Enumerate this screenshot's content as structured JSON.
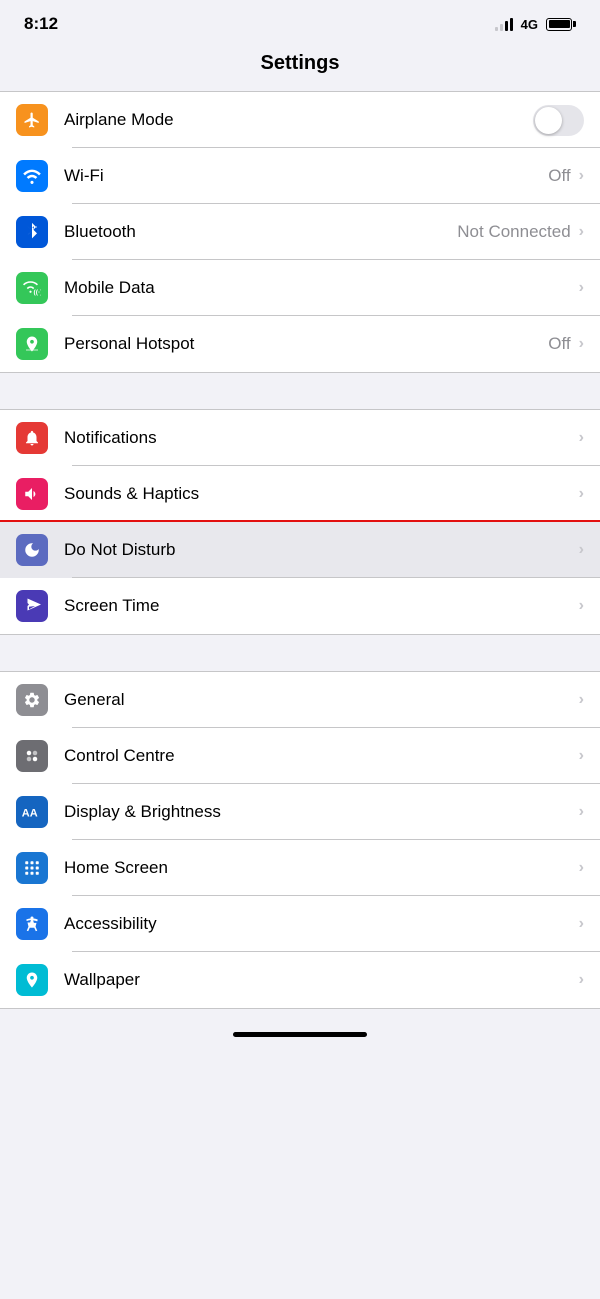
{
  "statusBar": {
    "time": "8:12",
    "networkType": "4G",
    "batteryFull": true
  },
  "pageTitle": "Settings",
  "groups": [
    {
      "id": "connectivity",
      "items": [
        {
          "id": "airplane-mode",
          "label": "Airplane Mode",
          "iconBg": "bg-orange",
          "iconSymbol": "✈",
          "hasToggle": true,
          "toggleOn": false,
          "value": "",
          "hasChevron": false
        },
        {
          "id": "wifi",
          "label": "Wi-Fi",
          "iconBg": "bg-blue",
          "iconSymbol": "wifi",
          "hasToggle": false,
          "value": "Off",
          "hasChevron": true
        },
        {
          "id": "bluetooth",
          "label": "Bluetooth",
          "iconBg": "bg-blue-dark",
          "iconSymbol": "bluetooth",
          "hasToggle": false,
          "value": "Not Connected",
          "hasChevron": true
        },
        {
          "id": "mobile-data",
          "label": "Mobile Data",
          "iconBg": "bg-green",
          "iconSymbol": "signal",
          "hasToggle": false,
          "value": "",
          "hasChevron": true
        },
        {
          "id": "personal-hotspot",
          "label": "Personal Hotspot",
          "iconBg": "bg-green",
          "iconSymbol": "hotspot",
          "hasToggle": false,
          "value": "Off",
          "hasChevron": true
        }
      ]
    },
    {
      "id": "notifications",
      "items": [
        {
          "id": "notifications",
          "label": "Notifications",
          "iconBg": "bg-red",
          "iconSymbol": "notif",
          "hasToggle": false,
          "value": "",
          "hasChevron": true
        },
        {
          "id": "sounds-haptics",
          "label": "Sounds & Haptics",
          "iconBg": "bg-red-pink",
          "iconSymbol": "sound",
          "hasToggle": false,
          "value": "",
          "hasChevron": true
        },
        {
          "id": "do-not-disturb",
          "label": "Do Not Disturb",
          "iconBg": "bg-purple",
          "iconSymbol": "moon",
          "hasToggle": false,
          "value": "",
          "hasChevron": true,
          "highlighted": true
        },
        {
          "id": "screen-time",
          "label": "Screen Time",
          "iconBg": "bg-purple-dark",
          "iconSymbol": "hourglass",
          "hasToggle": false,
          "value": "",
          "hasChevron": true
        }
      ]
    },
    {
      "id": "display",
      "items": [
        {
          "id": "general",
          "label": "General",
          "iconBg": "bg-gray",
          "iconSymbol": "gear",
          "hasToggle": false,
          "value": "",
          "hasChevron": true
        },
        {
          "id": "control-centre",
          "label": "Control Centre",
          "iconBg": "bg-gray2",
          "iconSymbol": "switches",
          "hasToggle": false,
          "value": "",
          "hasChevron": true
        },
        {
          "id": "display-brightness",
          "label": "Display & Brightness",
          "iconBg": "bg-blue2",
          "iconSymbol": "aa",
          "hasToggle": false,
          "value": "",
          "hasChevron": true
        },
        {
          "id": "home-screen",
          "label": "Home Screen",
          "iconBg": "bg-blue3",
          "iconSymbol": "grid",
          "hasToggle": false,
          "value": "",
          "hasChevron": true
        },
        {
          "id": "accessibility",
          "label": "Accessibility",
          "iconBg": "bg-blue-access",
          "iconSymbol": "person",
          "hasToggle": false,
          "value": "",
          "hasChevron": true
        },
        {
          "id": "wallpaper",
          "label": "Wallpaper",
          "iconBg": "bg-teal",
          "iconSymbol": "flower",
          "hasToggle": false,
          "value": "",
          "hasChevron": true,
          "partial": true
        }
      ]
    }
  ]
}
